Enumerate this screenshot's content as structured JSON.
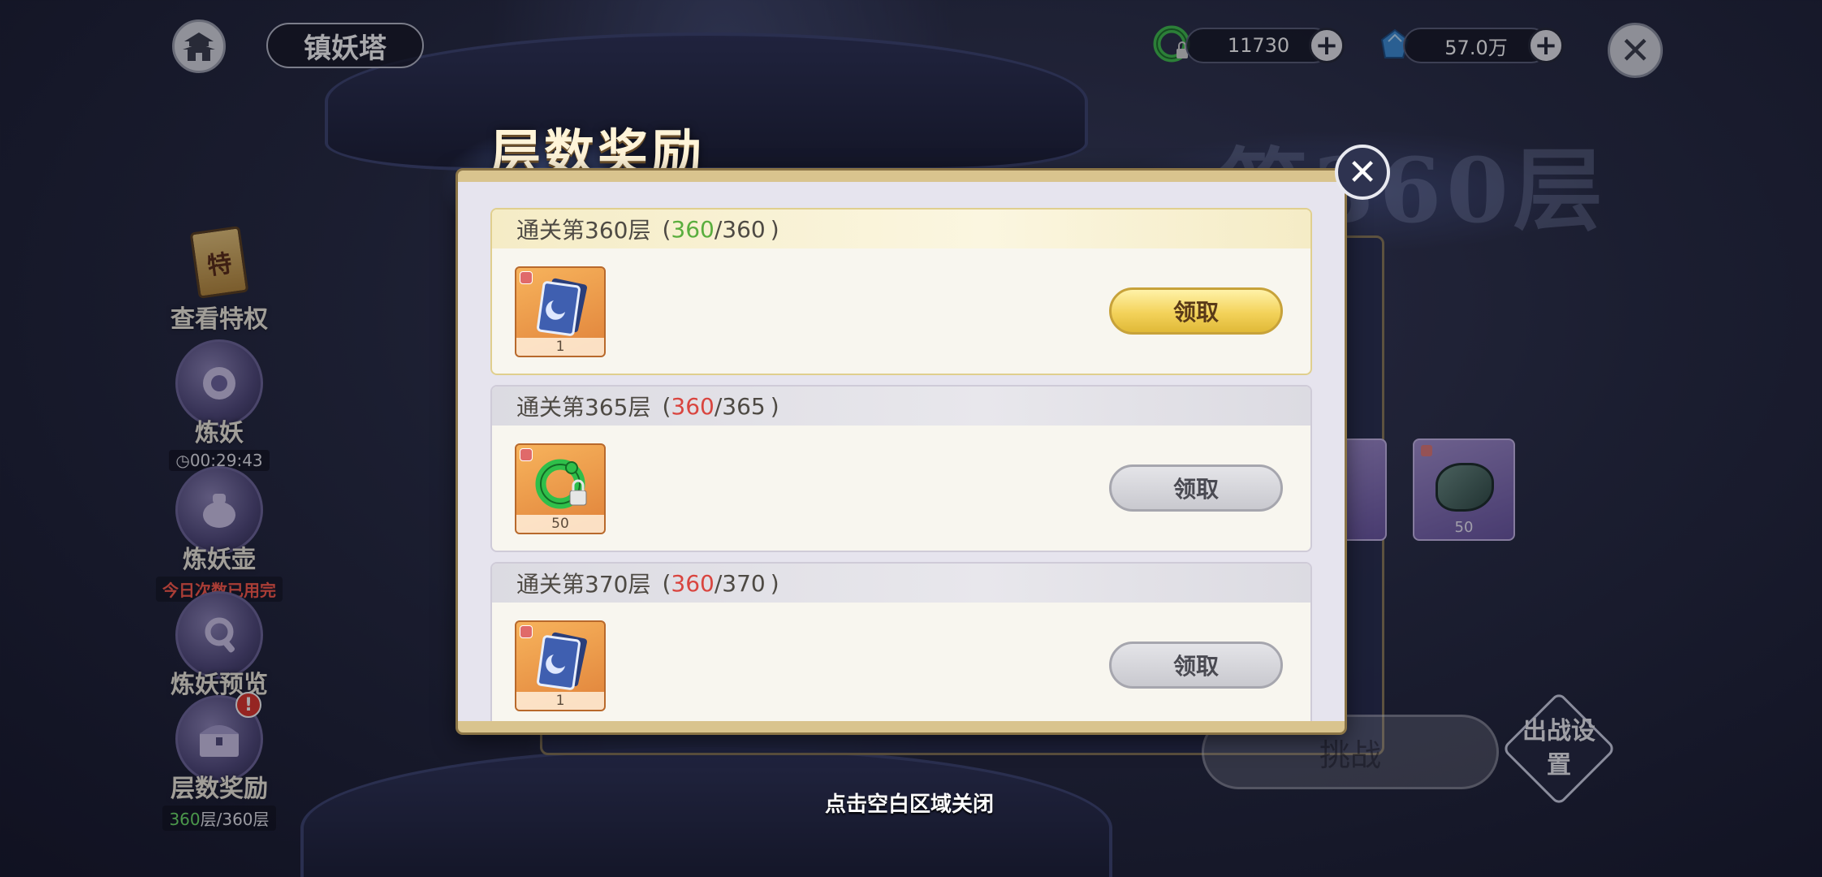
{
  "top_bar": {
    "location_title": "镇妖塔",
    "currency_jade": "11730",
    "currency_spirit": "57.0万"
  },
  "background": {
    "floor_title": "第360层",
    "challenge_label": "挑战",
    "battle_settings_label": "出战设置",
    "item_quantity": "50"
  },
  "sidebar": {
    "items": [
      {
        "label": "查看特权"
      },
      {
        "label": "炼妖",
        "sub": "00:29:43"
      },
      {
        "label": "炼妖壶",
        "sub": "今日次数已用完"
      },
      {
        "label": "炼妖预览"
      },
      {
        "label": "层数奖励",
        "sub_current": "360",
        "sub_rest": "层/360层",
        "badge": "!"
      }
    ]
  },
  "modal": {
    "title": "层数奖励",
    "rewards": [
      {
        "label": "通关第360层",
        "open": "(",
        "current": "360",
        "sep_total": "/360",
        "close": ")",
        "quantity": "1",
        "item": "card-icon",
        "button": "领取",
        "claimable": true
      },
      {
        "label": "通关第365层",
        "open": "(",
        "current": "360",
        "sep_total": "/365",
        "close": ")",
        "quantity": "50",
        "item": "dragon-jade-icon",
        "button": "领取",
        "claimable": false
      },
      {
        "label": "通关第370层",
        "open": "(",
        "current": "360",
        "sep_total": "/370",
        "close": ")",
        "quantity": "1",
        "item": "card-icon",
        "button": "领取",
        "claimable": false
      }
    ]
  },
  "hint": "点击空白区域关闭",
  "colors": {
    "progress_met": "#5aae3e",
    "progress_unmet": "#d9453f",
    "gold_border": "#d9c48e"
  }
}
